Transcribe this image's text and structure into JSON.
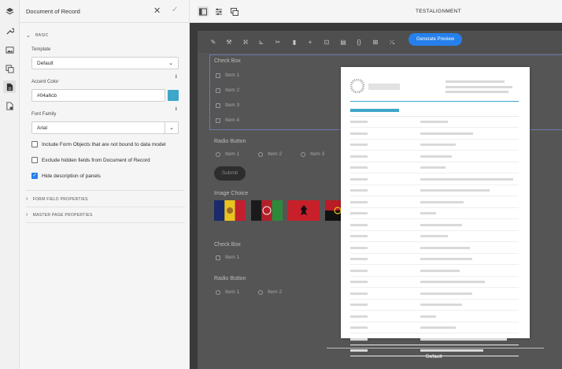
{
  "rail": {
    "icons": [
      "layers-icon",
      "wrench-icon",
      "image-icon",
      "copy-icon",
      "document-icon",
      "document-settings-icon"
    ]
  },
  "panel": {
    "title": "Document of Record",
    "basic_section": "BASIC",
    "template_label": "Template",
    "template_value": "Default",
    "accent_label": "Accent Color",
    "accent_value": "#04a6cb",
    "accent_swatch": "#3da6c9",
    "font_label": "Font Family",
    "font_value": "Arial",
    "checkbox1": "Include Form Objects that are not bound to data model",
    "checkbox1_checked": false,
    "checkbox2": "Exclude hidden fields from Document of Record",
    "checkbox2_checked": false,
    "checkbox3": "Hide description of panels",
    "checkbox3_checked": true,
    "form_field_section": "FORM FIELD PROPERTIES",
    "master_page_section": "MASTER PAGE PROPERTIES"
  },
  "topbar": {
    "form_title": "TESTALIGNMENT"
  },
  "canvas": {
    "generate_preview": "Generate Preview",
    "checkbox_title": "Check Box",
    "checkbox_items": [
      "Item 1",
      "Item 2",
      "Item 3",
      "Item 4"
    ],
    "radio_title": "Radio Button",
    "radio_items": [
      "Item 1",
      "Item 2",
      "Item 3"
    ],
    "submit": "Submit",
    "image_choice_title": "Image Choice",
    "checkbox2_title": "Check Box",
    "checkbox2_items": [
      "Item 1"
    ],
    "radio2_title": "Radio Button",
    "radio2_items": [
      "Item 1",
      "Item 2"
    ],
    "preview_label": "Default"
  },
  "colors": {
    "accent_blue": "#2680eb",
    "canvas_bg": "#3a3a3a",
    "sheet_accent": "#3da6c9"
  }
}
